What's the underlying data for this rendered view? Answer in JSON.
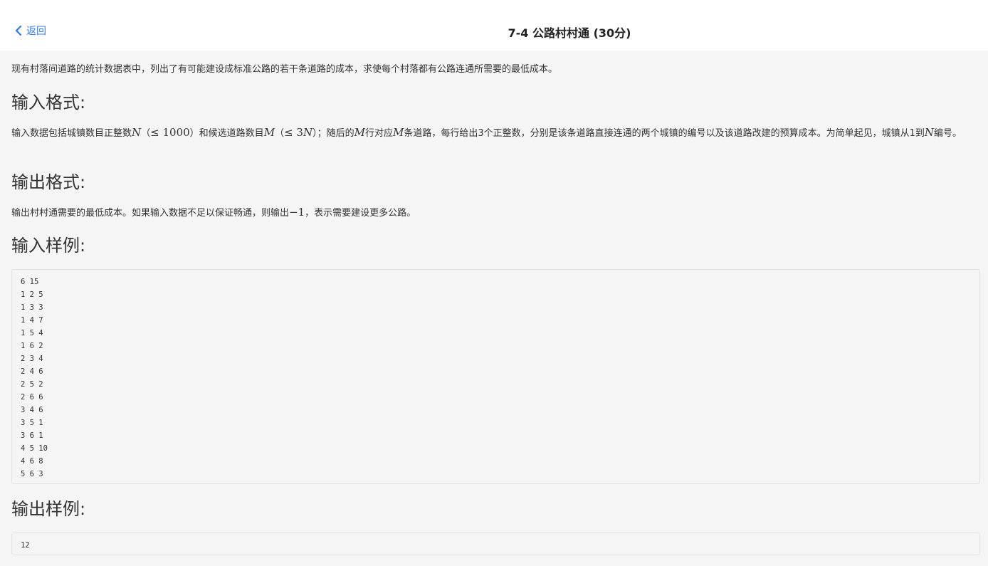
{
  "header": {
    "back_label": "返回",
    "title": "7-4 公路村村通 (30分)"
  },
  "description": "现有村落间道路的统计数据表中，列出了有可能建设成标准公路的若干条道路的成本，求使每个村落都有公路连通所需要的最低成本。",
  "input_format": {
    "heading": "输入格式:",
    "t1": "输入数据包括城镇数目正整数",
    "m1": "N",
    "t2": "（",
    "m2": "≤ 1000",
    "t3": "）和候选道路数目",
    "m3": "M",
    "t4": "（",
    "m4": "≤ 3",
    "m4b": "N",
    "t5": "）；随后的",
    "m5": "M",
    "t6": "行对应",
    "m6": "M",
    "t7": "条道路，每行给出3个正整数，分别是该条道路直接连通的两个城镇的编号以及该道路改建的预算成本。为简单起见，城镇从1到",
    "m7": "N",
    "t8": "编号。"
  },
  "output_format": {
    "heading": "输出格式:",
    "t1": "输出村村通需要的最低成本。如果输入数据不足以保证畅通，则输出",
    "m1": "−1",
    "t2": "，表示需要建设更多公路。"
  },
  "sample_input": {
    "heading": "输入样例:",
    "lines": [
      "6 15",
      "1 2 5",
      "1 3 3",
      "1 4 7",
      "1 5 4",
      "1 6 2",
      "2 3 4",
      "2 4 6",
      "2 5 2",
      "2 6 6",
      "3 4 6",
      "3 5 1",
      "3 6 1",
      "4 5 10",
      "4 6 8",
      "5 6 3"
    ]
  },
  "sample_output": {
    "heading": "输出样例:",
    "lines": [
      "12"
    ]
  },
  "colors": {
    "accent": "#2f7bf5",
    "page_bg": "#f5f5f5",
    "header_bg": "#ffffff"
  },
  "icons": {
    "back": "chevron-left-icon"
  }
}
